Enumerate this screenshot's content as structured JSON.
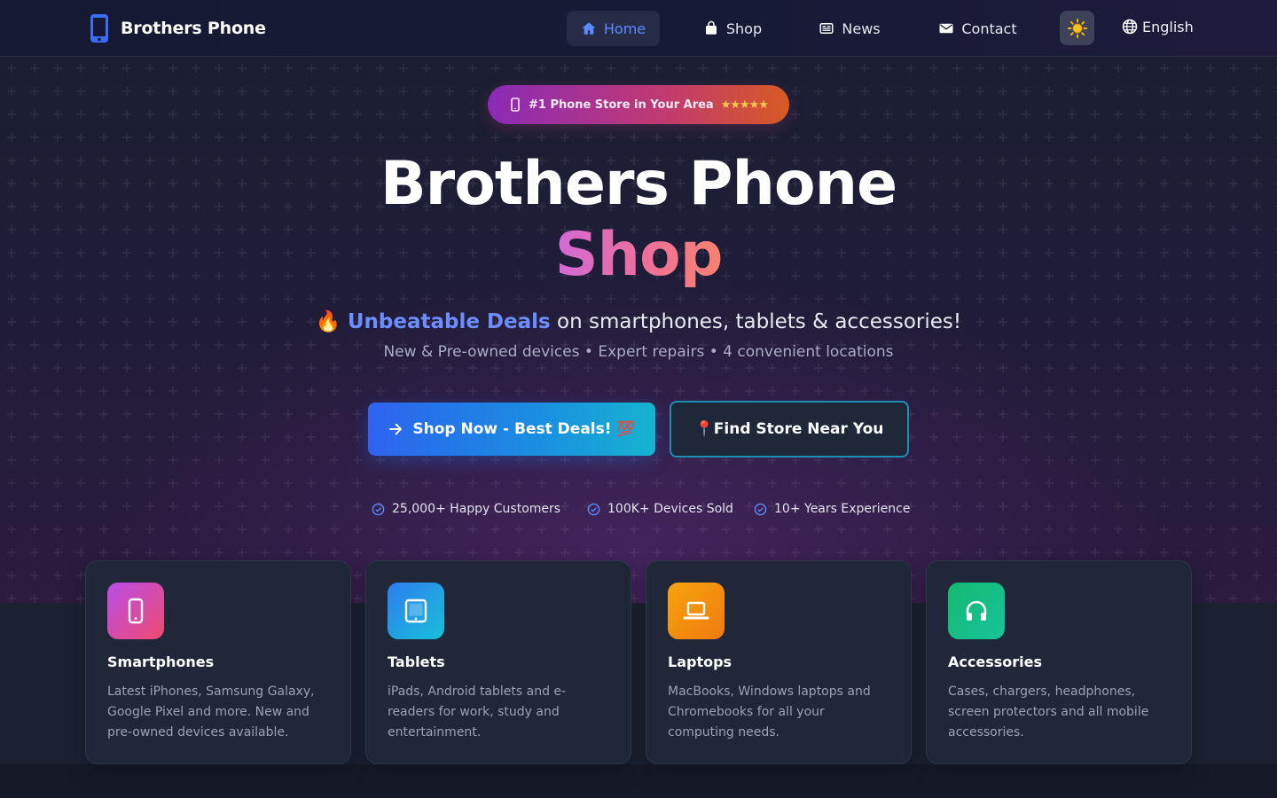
{
  "nav": {
    "brand": "Brothers Phone",
    "links": [
      {
        "label": "Home",
        "icon": "home-icon",
        "active": true
      },
      {
        "label": "Shop",
        "icon": "shopping-bag-icon",
        "active": false
      },
      {
        "label": "News",
        "icon": "newspaper-icon",
        "active": false
      },
      {
        "label": "Contact",
        "icon": "envelope-icon",
        "active": false
      }
    ],
    "theme_toggle_icon": "sun-icon",
    "language": "English"
  },
  "hero": {
    "badge_text": "#1 Phone Store in Your Area",
    "badge_stars": "★★★★★",
    "title_line1": "Brothers Phone",
    "title_line2": "Shop",
    "tagline_emoji": "🔥",
    "tagline_highlight": "Unbeatable Deals",
    "tagline_rest": "on smartphones, tablets & accessories!",
    "subline": "New & Pre-owned devices • Expert repairs • 4 convenient locations",
    "primary_cta": "Shop Now - Best Deals! 💯",
    "secondary_cta": "📍Find Store Near You",
    "stats": [
      "25,000+ Happy Customers",
      "100K+ Devices Sold",
      "10+ Years Experience"
    ]
  },
  "categories": [
    {
      "title": "Smartphones",
      "icon": "smartphone-icon",
      "description": "Latest iPhones, Samsung Galaxy, Google Pixel and more. New and pre-owned devices available."
    },
    {
      "title": "Tablets",
      "icon": "tablet-icon",
      "description": "iPads, Android tablets and e-readers for work, study and entertainment."
    },
    {
      "title": "Laptops",
      "icon": "laptop-icon",
      "description": "MacBooks, Windows laptops and Chromebooks for all your computing needs."
    },
    {
      "title": "Accessories",
      "icon": "headphones-icon",
      "description": "Cases, chargers, headphones, screen protectors and all mobile accessories."
    }
  ],
  "colors": {
    "accent_blue": "#5b8cff",
    "smartphones_gradient": [
      "#b94ee8",
      "#ef4a6e"
    ],
    "tablets_gradient": [
      "#2d7cf0",
      "#19c0d8"
    ],
    "laptops_gradient": [
      "#f59e0b",
      "#f07a12"
    ],
    "accessories_gradient": [
      "#14b870",
      "#18c49a"
    ]
  }
}
